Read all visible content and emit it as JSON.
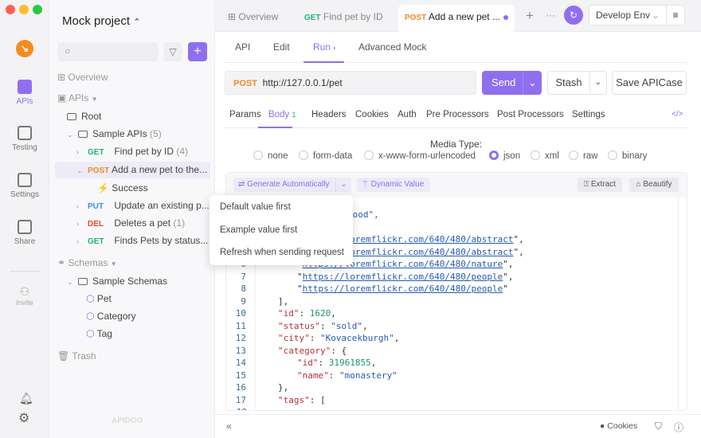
{
  "window": {
    "traffic_lights": [
      "#fe5f57",
      "#febc2e",
      "#28c840"
    ]
  },
  "rail": {
    "items": [
      {
        "label": "APIs",
        "active": true
      },
      {
        "label": "Testing"
      },
      {
        "label": "Settings"
      },
      {
        "label": "Share"
      },
      {
        "label": "Invite"
      }
    ]
  },
  "project": {
    "title": "Mock project",
    "search_placeholder": ""
  },
  "tree": {
    "overview": "Overview",
    "apis": "APIs",
    "root": "Root",
    "folder": {
      "name": "Sample APIs",
      "count": "(5)"
    },
    "items": [
      {
        "method": "GET",
        "name": "Find pet by ID",
        "count": "(4)"
      },
      {
        "method": "POST",
        "name": "Add a new pet to the...",
        "count": ""
      },
      {
        "method": "",
        "name": "Success",
        "count": ""
      },
      {
        "method": "PUT",
        "name": "Update an existing p...",
        "count": ""
      },
      {
        "method": "DEL",
        "name": "Deletes a pet",
        "count": "(1)"
      },
      {
        "method": "GET",
        "name": "Finds Pets by status...",
        "count": ""
      }
    ],
    "schemas": "Schemas",
    "schema_folder": "Sample Schemas",
    "schema_items": [
      "Pet",
      "Category",
      "Tag"
    ],
    "trash": "Trash",
    "watermark": "APIDOG"
  },
  "tabs": [
    {
      "label": "Overview"
    },
    {
      "method": "GET",
      "label": "Find pet by ID"
    },
    {
      "method": "POST",
      "label": "Add a new pet ...",
      "active": true
    }
  ],
  "env": {
    "label": "Develop Env"
  },
  "subtabs": [
    "API",
    "Edit",
    "Run",
    "Advanced Mock"
  ],
  "request": {
    "method": "POST",
    "url": "http://127.0.0.1/pet",
    "send": "Send",
    "stash": "Stash",
    "save": "Save APICase"
  },
  "param_tabs": [
    "Params",
    "Body",
    "Headers",
    "Cookies",
    "Auth",
    "Pre Processors",
    "Post Processors",
    "Settings"
  ],
  "body_count": "1",
  "media": {
    "label": "Media Type:",
    "options": [
      "none",
      "form-data",
      "x-www-form-urlencoded",
      "json",
      "xml",
      "raw",
      "binary"
    ],
    "selected": "json"
  },
  "toolbar": {
    "generate": "Generate Automatically",
    "dynamic": "Dynamic Value",
    "extract": "Extract",
    "beautify": "Beautify"
  },
  "menu": [
    "Default value first",
    "Example value first",
    "Refresh when sending request"
  ],
  "code": {
    "line2_tail": "hood\",",
    "urls": [
      "https://loremflickr.com/640/480/abstract",
      "https://loremflickr.com/640/480/abstract",
      "https://loremflickr.com/640/480/nature",
      "https://loremflickr.com/640/480/people",
      "https://loremflickr.com/640/480/people"
    ],
    "id": "1620",
    "status": "sold",
    "city": "Kovacekburgh",
    "cat_id": "31961855",
    "cat_name": "monastery",
    "line_numbers": [
      "6",
      "7",
      "8",
      "9",
      "10",
      "11",
      "12",
      "13",
      "14",
      "15",
      "16",
      "17",
      "18"
    ]
  },
  "footer": {
    "cookies": "Cookies"
  },
  "accent": "#8f6ff0"
}
